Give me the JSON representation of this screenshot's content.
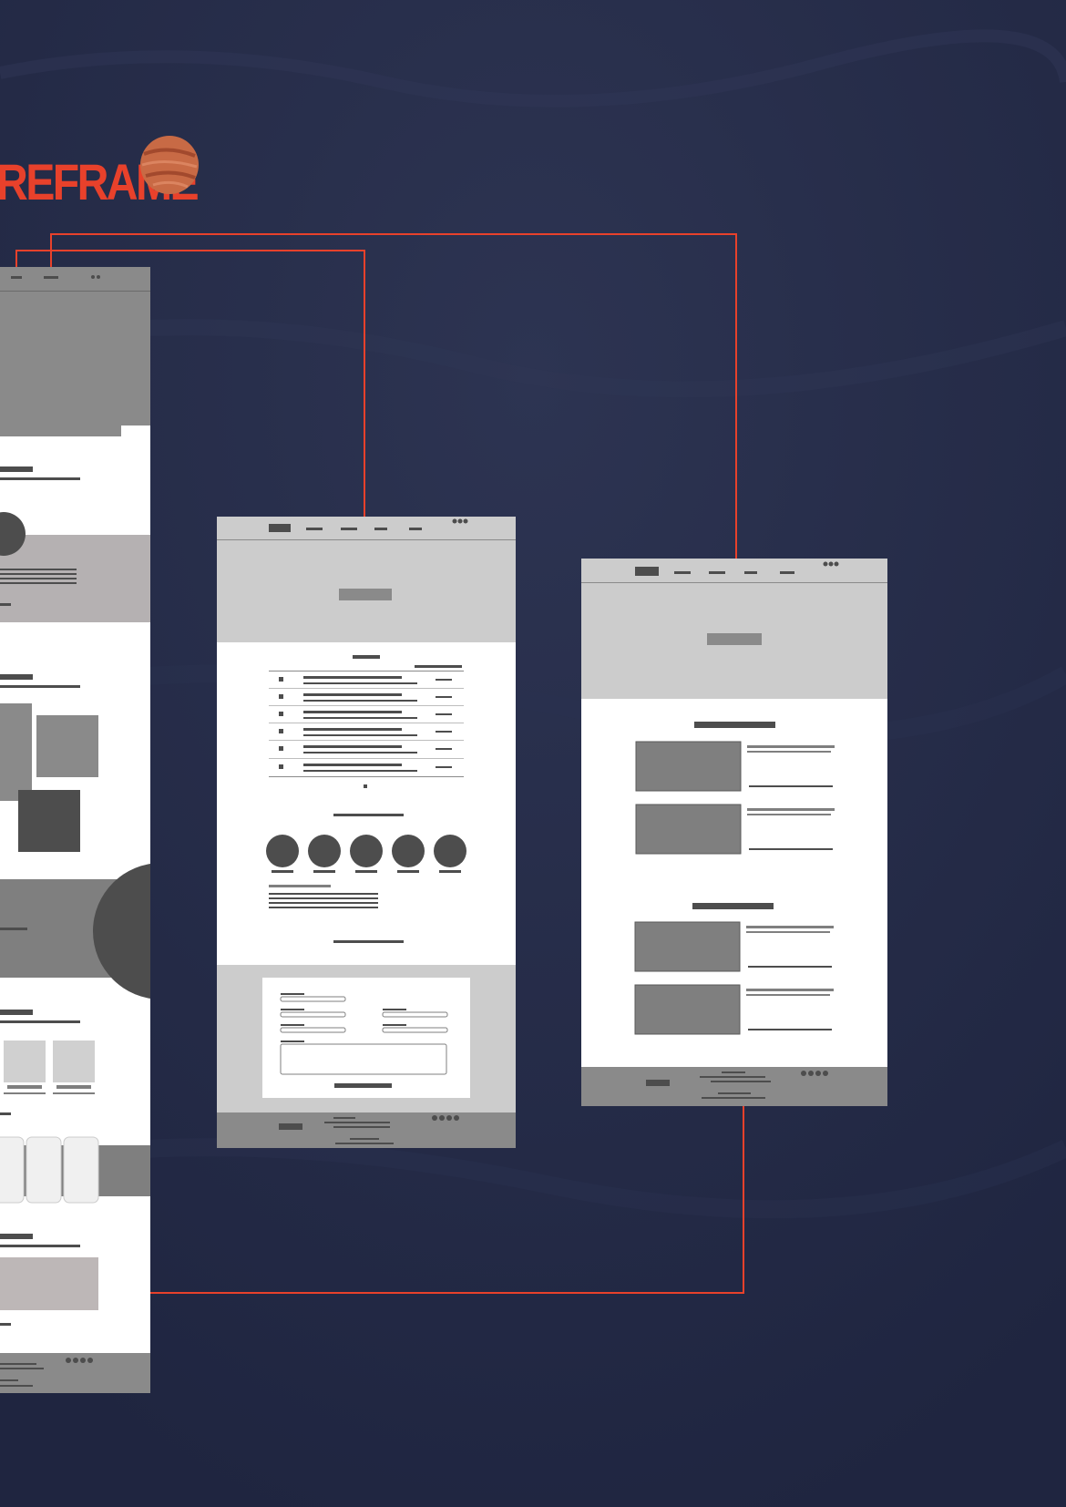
{
  "title": "REFRAME",
  "colors": {
    "background": "#232944",
    "accent": "#e8412b",
    "planet": "#c86a45",
    "wire_dark": "#4d4d4d",
    "wire_mid": "#7f7f7f",
    "wire_light": "#cccccc"
  },
  "icons": [
    "planet-icon"
  ],
  "frames": [
    {
      "name": "wireframe-home",
      "sections": [
        "header-nav",
        "hero",
        "intro",
        "feature-banner",
        "image-grid",
        "circle-banner",
        "card-row",
        "slider-cards",
        "contact-block",
        "footer"
      ]
    },
    {
      "name": "wireframe-list-page",
      "sections": [
        "header-nav",
        "hero",
        "list-table",
        "pagination",
        "team-circles",
        "text-block",
        "contact-form",
        "footer"
      ]
    },
    {
      "name": "wireframe-article-page",
      "sections": [
        "header-nav",
        "hero",
        "article-list-1",
        "article-list-2",
        "footer"
      ]
    }
  ]
}
